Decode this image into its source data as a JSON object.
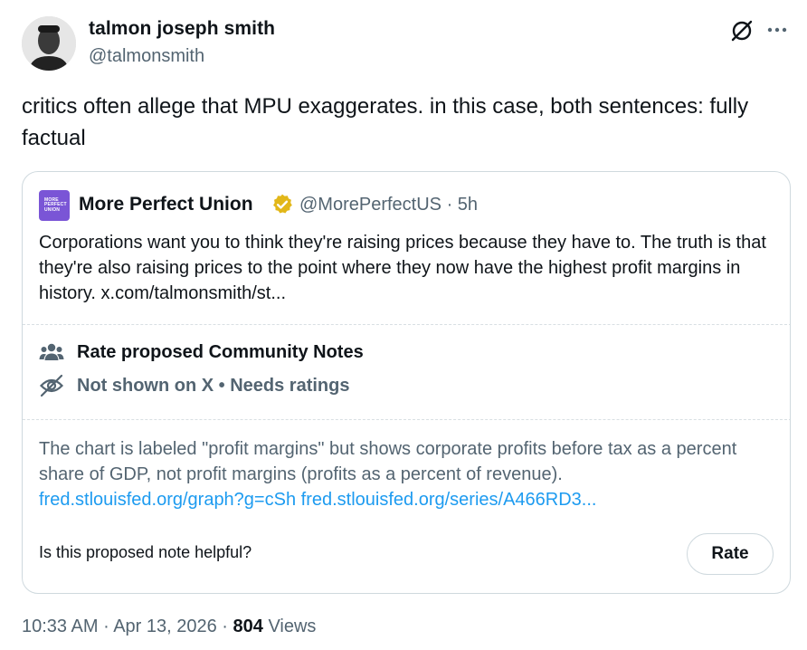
{
  "author": {
    "name": "talmon joseph smith",
    "handle": "@talmonsmith"
  },
  "tweet": {
    "text": "critics often allege that MPU exaggerates. in this case, both sentences: fully factual"
  },
  "quoted": {
    "avatar_text": [
      "MORE",
      "PERFECT",
      "UNION"
    ],
    "name": "More Perfect Union",
    "handle": "@MorePerfectUS",
    "separator": " · ",
    "time": "5h",
    "text": "Corporations want you to think they're raising prices because they have to. The truth is that they're also raising prices to the point where they now have the highest profit margins in history. x.com/talmonsmith/st..."
  },
  "community_notes": {
    "title": "Rate proposed Community Notes",
    "status": "Not shown on X • Needs ratings",
    "note_text": "The chart is labeled \"profit margins\" but shows corporate profits before tax as a percent share of GDP, not profit margins (profits as a percent of revenue).",
    "links": [
      "fred.stlouisfed.org/graph?g=cSh",
      "fred.stlouisfed.org/series/A466RD3..."
    ],
    "helpful_question": "Is this proposed note helpful?",
    "rate_label": "Rate"
  },
  "meta": {
    "time": "10:33 AM",
    "separator": " · ",
    "date": "Apr 13, 2026",
    "views_count": "804",
    "views_label": "Views"
  },
  "icons": {
    "grok": "grok-icon",
    "more": "more-icon",
    "verified": "verified-badge-icon",
    "people": "people-icon",
    "eye_off": "eye-off-icon"
  },
  "colors": {
    "text_primary": "#0f1419",
    "text_secondary": "#536471",
    "link": "#1d9bf0",
    "border": "#cfd9de",
    "verified_gold": "#e2b719",
    "mpu_purple": "#7a55d6"
  }
}
